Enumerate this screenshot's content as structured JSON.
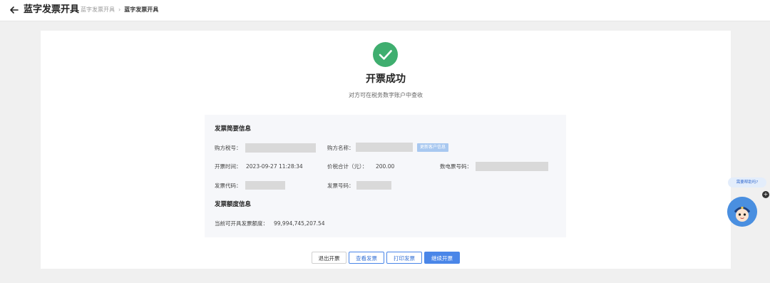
{
  "header": {
    "title": "蓝字发票开具",
    "breadcrumb": [
      "蓝字发票开具",
      "蓝字发票开具"
    ]
  },
  "result": {
    "title": "开票成功",
    "subtitle": "对方可在税务数字账户中查收"
  },
  "summary": {
    "title": "发票简要信息",
    "buyer_tax_id_label": "购方税号：",
    "buyer_name_label": "购方名称：",
    "update_customer_btn": "更新客户信息",
    "issue_time_label": "开票时间：",
    "issue_time_value": "2023-09-27 11:28:34",
    "total_label": "价税合计（元）：",
    "total_value": "200.00",
    "digital_no_label": "数电票号码：",
    "invoice_code_label": "发票代码：",
    "invoice_no_label": "发票号码："
  },
  "quota": {
    "title": "发票额度信息",
    "available_label": "当前可开具发票额度：",
    "available_value": "99,994,745,207.54"
  },
  "actions": {
    "exit": "退出开票",
    "view": "查看发票",
    "print": "打印发票",
    "continue": "继续开票"
  },
  "helper": {
    "bubble": "需要帮助吗?"
  },
  "colors": {
    "primary": "#4a86e8",
    "success": "#3fae6f"
  }
}
